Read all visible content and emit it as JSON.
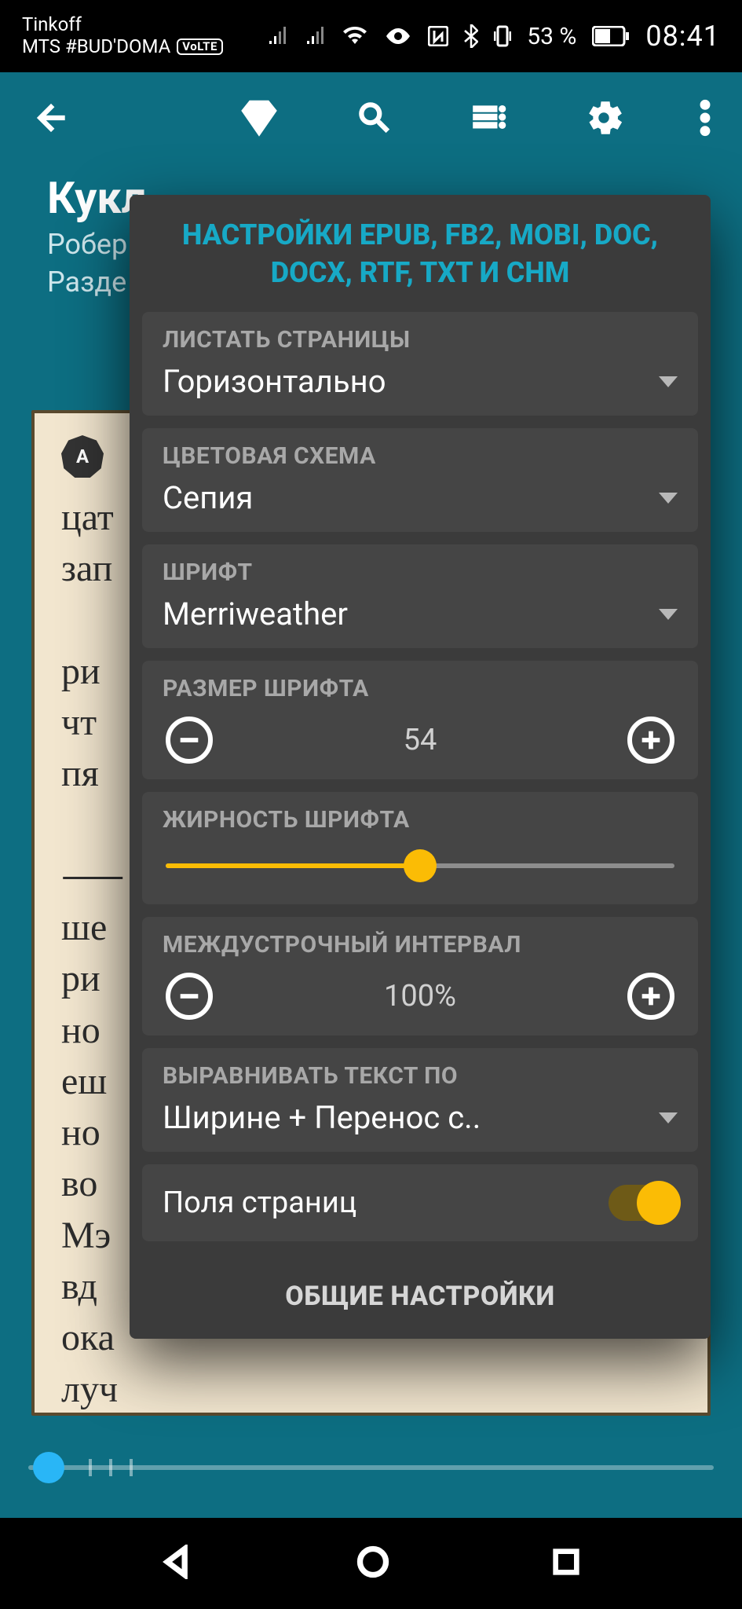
{
  "statusbar": {
    "carrier1": "Tinkoff",
    "carrier2": "MTS #BUD'DOMA",
    "volte": "VoLTE",
    "battery_pct": "53 %",
    "clock": "08:41"
  },
  "toolbar": {
    "icons": [
      "back",
      "diamond",
      "search",
      "list",
      "gear",
      "more"
    ]
  },
  "book": {
    "title": "Кукл",
    "author": "Робер",
    "section": "Разде"
  },
  "reader": {
    "auto_badge": "A",
    "text": "цат\nзап\n\nри\nчт\nпя\n\n    ⸺\nше\nри\nно\nеш\nно\nво\nМэ\nвд\nока\nлуч\nв\nно\nко"
  },
  "popup": {
    "header": "НАСТРОЙКИ EPUB, FB2, MOBI, DOC, DOCX, RTF, TXT И CHM",
    "sections": {
      "paging": {
        "label": "ЛИСТАТЬ СТРАНИЦЫ",
        "value": "Горизонтально"
      },
      "colors": {
        "label": "ЦВЕТОВАЯ СХЕМА",
        "value": "Сепия"
      },
      "font": {
        "label": "ШРИФТ",
        "value": "Merriweather"
      },
      "fontsize": {
        "label": "РАЗМЕР ШРИФТА",
        "value": "54"
      },
      "weight": {
        "label": "ЖИРНОСТЬ ШРИФТА",
        "percent": 50
      },
      "linespacing": {
        "label": "МЕЖДУСТРОЧНЫЙ ИНТЕРВАЛ",
        "value": "100%"
      },
      "align": {
        "label": "ВЫРАВНИВАТЬ ТЕКСТ ПО",
        "value": "Ширине + Перенос с.."
      },
      "margins": {
        "label": "Поля страниц",
        "on": true
      }
    },
    "footer": "ОБЩИЕ НАСТРОЙКИ"
  }
}
